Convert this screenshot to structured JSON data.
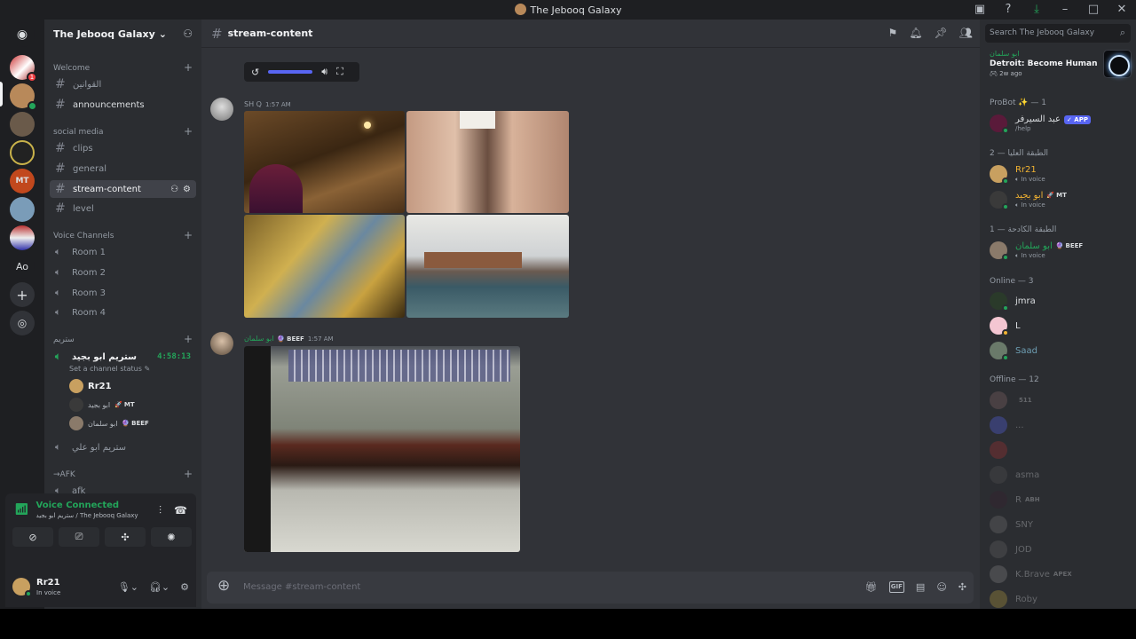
{
  "window": {
    "title": "The Jebooq Galaxy"
  },
  "server": {
    "name": "The Jebooq Galaxy"
  },
  "rail": {
    "items": [
      {
        "name": "discord-home",
        "label": ""
      },
      {
        "name": "server-1",
        "label": ""
      },
      {
        "name": "server-2",
        "label": ""
      },
      {
        "name": "server-3",
        "label": ""
      },
      {
        "name": "server-4",
        "label": ""
      },
      {
        "name": "server-mt",
        "label": "MT"
      },
      {
        "name": "server-5",
        "label": ""
      },
      {
        "name": "server-6",
        "label": ""
      },
      {
        "name": "server-ao",
        "label": "Ao"
      }
    ]
  },
  "sidebar": {
    "categories": {
      "welcome": "Welcome",
      "social": "social media",
      "voice": "Voice Channels",
      "stream": "ستريم",
      "afk": "→AFK"
    },
    "channels": {
      "rules": "القوانين",
      "announcements": "announcements",
      "clips": "clips",
      "general": "general",
      "stream_content": "stream-content",
      "level": "level"
    },
    "voice_rooms": [
      "Room 1",
      "Room 2",
      "Room 3",
      "Room 4"
    ],
    "stream_channel": {
      "name": "ستريم ابو بجيد",
      "timer": "4:58:13",
      "status": "Set a channel status"
    },
    "voice_users": [
      {
        "name": "Rr21",
        "badge": ""
      },
      {
        "name": "ابو بجيد",
        "badge": "MT"
      },
      {
        "name": "ابو سلمان",
        "badge": "BEEF"
      }
    ],
    "stream_channel_2": "ستريم ابو علي",
    "afk_channel": "afk"
  },
  "voice_connected": {
    "title": "Voice Connected",
    "sub": "ستريم ابو بجيد / The Jebooq Galaxy"
  },
  "user_panel": {
    "name": "Rr21",
    "status": "In voice"
  },
  "chat": {
    "channel": "stream-content",
    "messages": [
      {
        "author": "SH Q",
        "time": "1:57 AM"
      },
      {
        "author": "ابو سلمان",
        "badge": "BEEF",
        "time": "1:57 AM"
      }
    ],
    "placeholder": "Message #stream-content"
  },
  "members": {
    "search_placeholder": "Search The Jebooq Galaxy",
    "activity": {
      "who": "ابو سلمان",
      "game": "Detroit: Become Human",
      "ago": "2w ago"
    },
    "groups": {
      "probot": "ProBot ✨ — 1",
      "upper": "الطبقة العليا — 2",
      "crushing": "الطبقة الكادحة — 1",
      "online": "Online — 3",
      "offline": "Offline — 12"
    },
    "probot_member": {
      "name": "عبد السيرفر",
      "tag": "✓ APP",
      "sub": "/help"
    },
    "upper_members": [
      {
        "name": "Rr21",
        "sub": "In voice",
        "tag": ""
      },
      {
        "name": "ابو بجيد",
        "sub": "In voice",
        "tag": "MT"
      }
    ],
    "crushing_member": {
      "name": "ابو سلمان",
      "sub": "In voice",
      "tag": "BEEF"
    },
    "online_members": [
      "jmra",
      "L",
      "Saad"
    ],
    "offline_members": [
      {
        "name": "",
        "tag": "511"
      },
      {
        "name": "...",
        "tag": ""
      },
      {
        "name": "",
        "tag": ""
      },
      {
        "name": "asma",
        "tag": ""
      },
      {
        "name": "R",
        "tag": "ABH"
      },
      {
        "name": "SNY",
        "tag": ""
      },
      {
        "name": "JOD",
        "tag": ""
      },
      {
        "name": "K.Brave",
        "tag": "APEX"
      },
      {
        "name": "Roby",
        "tag": ""
      }
    ]
  }
}
